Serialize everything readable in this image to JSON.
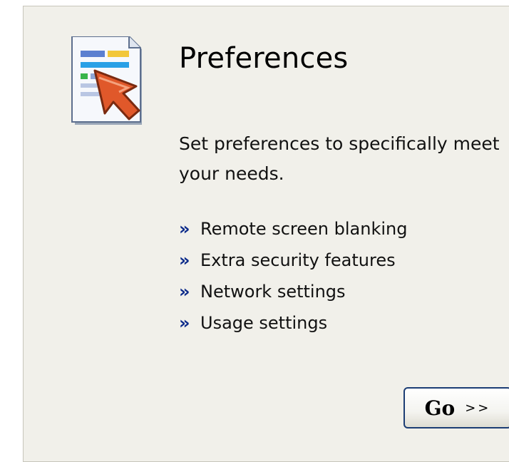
{
  "panel": {
    "title": "Preferences",
    "description": "Set preferences to specifically meet your needs.",
    "icon": "preferences-page-icon",
    "bullet_glyph": "»",
    "features": [
      {
        "label": "Remote screen blanking"
      },
      {
        "label": "Extra security features"
      },
      {
        "label": "Network settings"
      },
      {
        "label": "Usage settings"
      }
    ],
    "go_button": {
      "label": "Go",
      "arrows": ">>"
    }
  },
  "colors": {
    "panel_background": "#f1f0ea",
    "bullet": "#0b2a8a",
    "button_border": "#1c3d74",
    "icon_arrow": "#e0582a"
  }
}
